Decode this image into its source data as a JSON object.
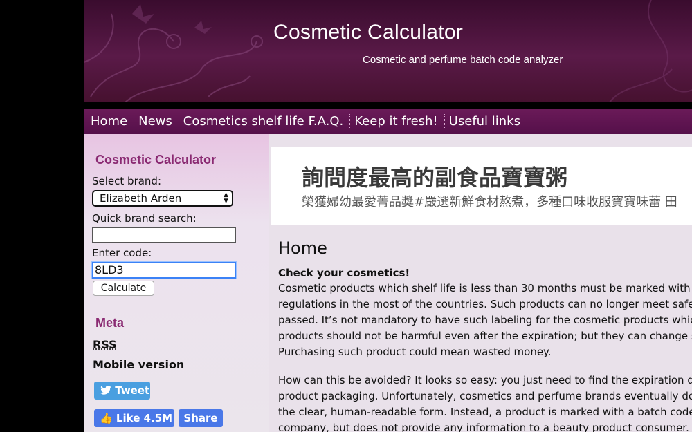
{
  "header": {
    "title": "Cosmetic Calculator",
    "subtitle": "Cosmetic and perfume batch code analyzer"
  },
  "nav": [
    "Home",
    "News",
    "Cosmetics shelf life F.A.Q.",
    "Keep it fresh!",
    "Useful links"
  ],
  "sidebar": {
    "heading": "Cosmetic Calculator",
    "brand_label": "Select brand:",
    "brand_value": "Elizabeth Arden",
    "quick_search_label": "Quick brand search:",
    "quick_search_value": "",
    "code_label": "Enter code:",
    "code_value": "8LD3",
    "calculate_label": "Calculate",
    "meta_heading": "Meta",
    "rss_label": "RSS",
    "mobile_label": "Mobile version",
    "tweet_label": "Tweet",
    "like_label": "Like 4.5M",
    "share_label": "Share"
  },
  "ad": {
    "title": "詢問度最高的副食品寶寶粥",
    "subtitle": "榮獲婦幼最愛菁品獎#嚴選新鮮食材熬煮，多種口味收服寶寶味蕾 田"
  },
  "content": {
    "heading": "Home",
    "lead": "Check your cosmetics!",
    "para1": [
      "Cosmetic products which shelf life is less than 30 months must be marked with",
      "regulations in the most of the countries. Such products can no longer meet safe",
      "passed. It’s not mandatory to have such labeling for the cosmetic products whic",
      "products should not be harmful even after the expiration; but they can change s",
      "Purchasing such product could mean wasted money."
    ],
    "para2": [
      "How can this be avoided? It looks so easy: you just need to find the expiration d",
      "product packaging. Unfortunately, cosmetics and perfume brands eventually do",
      "the clear, human-readable form. Instead, a product is marked with a batch code",
      "company, but does not provide any information to a beauty product consumer. I"
    ]
  },
  "colors": {
    "header_bg": "#4a1440",
    "nav_bg": "#5e1550",
    "sidebar_heading": "#8a2a72",
    "tweet_bg": "#4a9fe0",
    "facebook_bg": "#4a78e8"
  }
}
